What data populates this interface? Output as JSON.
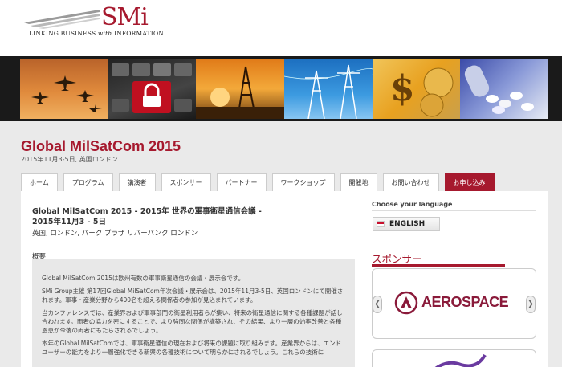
{
  "logo": {
    "brand": "SMi",
    "tagline_part1": "LINKING BUSINESS ",
    "tagline_with": "with",
    "tagline_part2": " INFORMATION"
  },
  "page": {
    "title": "Global MilSatCom 2015",
    "subtitle": "2015年11月3-5日, 英国ロンドン"
  },
  "tabs": [
    {
      "label": "ホーム",
      "active": false
    },
    {
      "label": "プログラム",
      "active": false
    },
    {
      "label": "講演者",
      "active": false
    },
    {
      "label": "スポンサー",
      "active": false
    },
    {
      "label": "パートナー",
      "active": false
    },
    {
      "label": "ワークショップ",
      "active": false
    },
    {
      "label": "開催地",
      "active": false
    },
    {
      "label": "お問い合わせ",
      "active": false
    },
    {
      "label": "お申し込み",
      "active": true
    }
  ],
  "event": {
    "title_line1": "Global MilSatCom 2015 - 2015年 世界の軍事衛星通信会議 -",
    "title_line2": "2015年11月3 - 5日",
    "location": "英国, ロンドン, パーク プラザ リバーバンク ロンドン"
  },
  "overview": {
    "label": "概要",
    "paragraphs": [
      "Global MilSatCom 2015は欧州有数の軍事衛星通信の会議・展示会です。",
      "SMi Group主催 第17回Global MilSatCom年次会議・展示会は、2015年11月3-5日、英国ロンドンにて開催されます。軍事・産業分野から400名を超える関係者の参加が見込まれています。",
      "当カンファレンスでは、産業界および軍事部門の衛星利用者らが集い、将来の衛星通信に関する各種課題が話し合われます。両者の協力を密にすることで、より強固な関係が構築され、その結果、より一層の効率改善と各種恩恵が今後の両者にもたらされるでしょう。",
      "本年のGlobal MilSatComでは、軍事衛星通信の現在および将来の課題に取り組みます。産業界からは、エンドユーザーの能力をより一層強化できる新興の各種技術について明らかにされるでしょう。これらの技術に"
    ]
  },
  "sidebar": {
    "language_label": "Choose your language",
    "language_button": "ENGLISH",
    "sponsors_label": "スポンサー",
    "sponsor_name": "AEROSPACE",
    "prev_glyph": "❮",
    "next_glyph": "❯"
  },
  "colors": {
    "brand": "#a6192e",
    "sponsor": "#8a1a3a"
  }
}
